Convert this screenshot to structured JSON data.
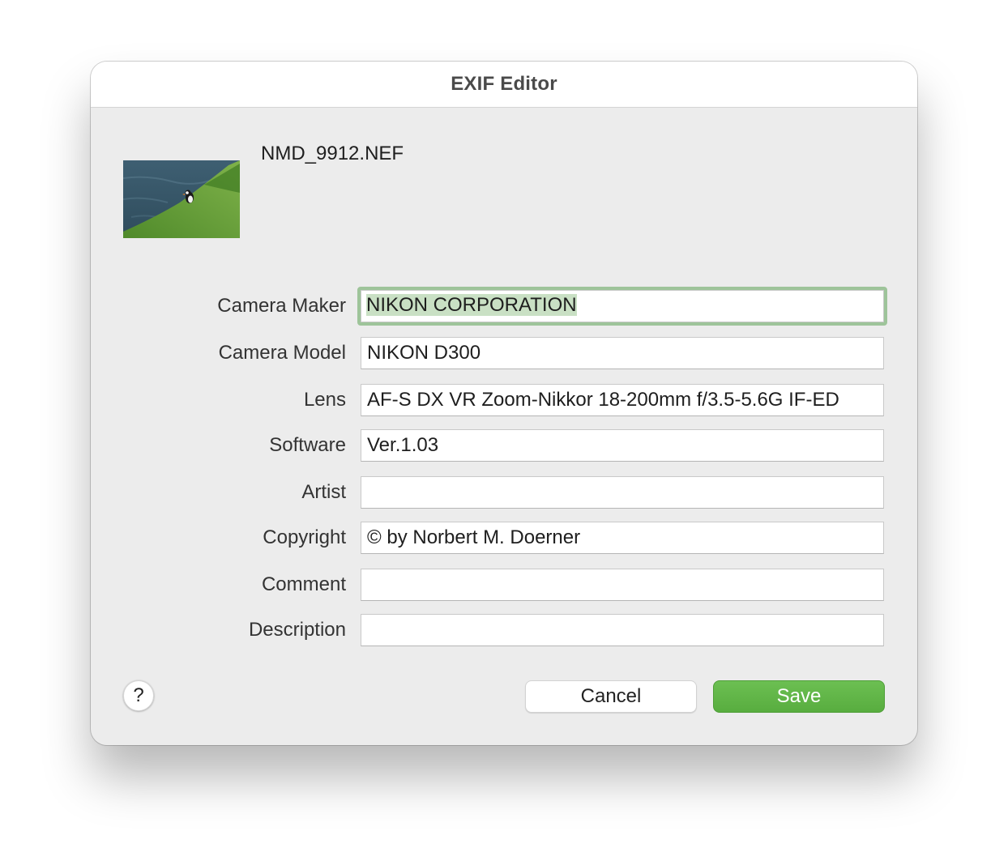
{
  "dialog": {
    "title": "EXIF Editor",
    "filename": "NMD_9912.NEF"
  },
  "fields": [
    {
      "label": "Camera Maker",
      "value": "NIKON CORPORATION",
      "focused": true,
      "selected": true
    },
    {
      "label": "Camera Model",
      "value": "NIKON D300"
    },
    {
      "label": "Lens",
      "value": "AF-S DX VR Zoom-Nikkor 18-200mm f/3.5-5.6G IF-ED"
    },
    {
      "label": "Software",
      "value": "Ver.1.03"
    },
    {
      "label": "Artist",
      "value": ""
    },
    {
      "label": "Copyright",
      "value": "© by Norbert M. Doerner"
    },
    {
      "label": "Comment",
      "value": ""
    },
    {
      "label": "Description",
      "value": ""
    }
  ],
  "buttons": {
    "help_label": "?",
    "cancel_label": "Cancel",
    "save_label": "Save"
  },
  "colors": {
    "accent_green": "#5db444",
    "focus_ring": "#9ec49a",
    "selection": "#c9e0c4"
  },
  "icons": {
    "thumbnail": "puffin-photo-thumbnail",
    "help": "question-mark-icon"
  }
}
